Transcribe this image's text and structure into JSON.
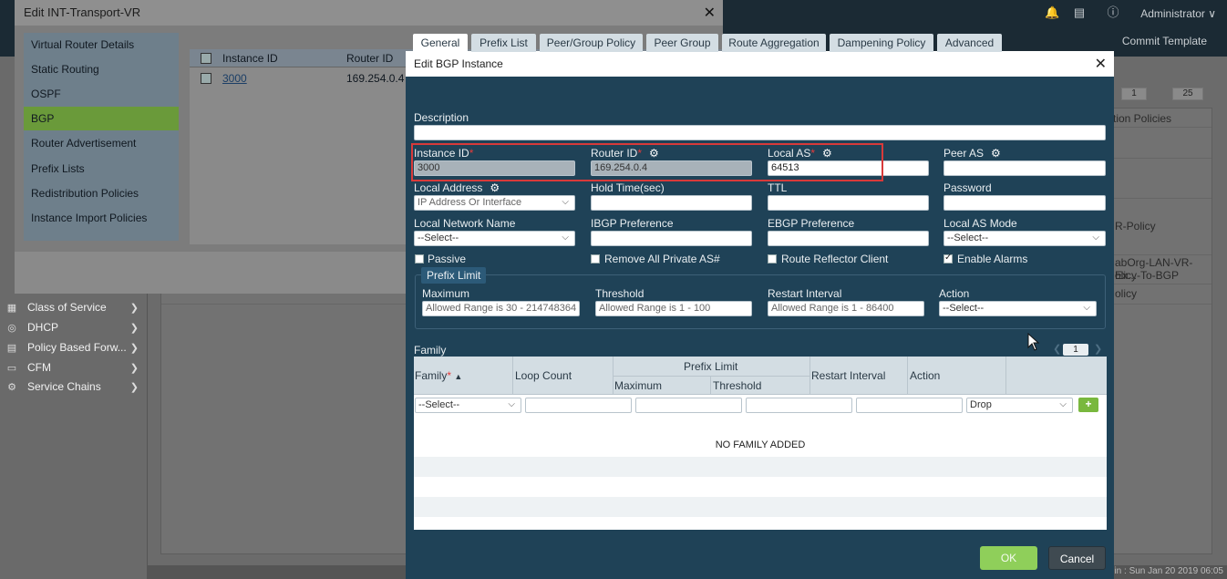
{
  "topbar": {
    "user": "Administrator ∨",
    "commit_template": "Commit Template"
  },
  "leftnav": {
    "items": [
      {
        "label": "Class of Service",
        "icon": "class-of-service-icon"
      },
      {
        "label": "DHCP",
        "icon": "dhcp-icon"
      },
      {
        "label": "Policy Based Forw...",
        "icon": "pbf-icon"
      },
      {
        "label": "CFM",
        "icon": "cfm-icon"
      },
      {
        "label": "Service Chains",
        "icon": "gear-icon"
      }
    ]
  },
  "background": {
    "pager_value": "1",
    "page_size": "25",
    "col_header": "tion Policies",
    "right_texts": [
      "R-Policy",
      "abOrg-LAN-VR-Ex...",
      "olicy-To-BGP",
      "olicy"
    ],
    "status": "gin : Sun Jan 20 2019 06:05"
  },
  "dialog1": {
    "title": "Edit INT-Transport-VR",
    "menu": [
      "Virtual Router Details",
      "Static Routing",
      "OSPF",
      "BGP",
      "Router Advertisement",
      "Prefix Lists",
      "Redistribution Policies",
      "Instance Import Policies"
    ],
    "active_menu": "BGP",
    "grid_headers": [
      "Instance ID",
      "Router ID"
    ],
    "grid_row": {
      "instance_id": "3000",
      "router_id": "169.254.0.4"
    },
    "pager_value": "1",
    "page_size": "25"
  },
  "dialog": {
    "title": "Edit BGP Instance",
    "tabs": [
      "General",
      "Prefix List",
      "Peer/Group Policy",
      "Peer Group",
      "Route Aggregation",
      "Dampening Policy",
      "Advanced"
    ],
    "active_tab": "General",
    "description_label": "Description",
    "description_value": "",
    "instance_id_label": "Instance ID",
    "instance_id_value": "3000",
    "router_id_label": "Router ID",
    "router_id_value": "169.254.0.4",
    "local_as_label": "Local AS",
    "local_as_value": "64513",
    "peer_as_label": "Peer AS",
    "peer_as_value": "",
    "local_address_label": "Local Address",
    "local_address_placeholder": "IP Address Or Interface",
    "hold_time_label": "Hold Time(sec)",
    "ttl_label": "TTL",
    "password_label": "Password",
    "local_network_name_label": "Local Network Name",
    "local_network_name_value": "--Select--",
    "ibgp_pref_label": "IBGP Preference",
    "ebgp_pref_label": "EBGP Preference",
    "local_as_mode_label": "Local AS Mode",
    "local_as_mode_value": "--Select--",
    "passive_label": "Passive",
    "remove_private_label": "Remove All Private AS#",
    "route_reflector_label": "Route Reflector Client",
    "enable_alarms_label": "Enable Alarms",
    "prefix_limit": {
      "tag": "Prefix Limit",
      "maximum_label": "Maximum",
      "maximum_placeholder": "Allowed Range is 30 - 214748364",
      "threshold_label": "Threshold",
      "threshold_placeholder": "Allowed Range is 1 - 100",
      "restart_label": "Restart Interval",
      "restart_placeholder": "Allowed Range is 1 - 86400",
      "action_label": "Action",
      "action_value": "--Select--"
    },
    "family": {
      "section_label": "Family",
      "pager_value": "1",
      "headers": {
        "family": "Family",
        "loop_count": "Loop Count",
        "prefix_limit": "Prefix Limit",
        "maximum": "Maximum",
        "threshold": "Threshold",
        "restart_interval": "Restart Interval",
        "action": "Action"
      },
      "new_row": {
        "family_value": "--Select--",
        "action_value": "Drop"
      },
      "empty_text": "NO FAMILY ADDED"
    },
    "ok_label": "OK",
    "cancel_label": "Cancel"
  }
}
